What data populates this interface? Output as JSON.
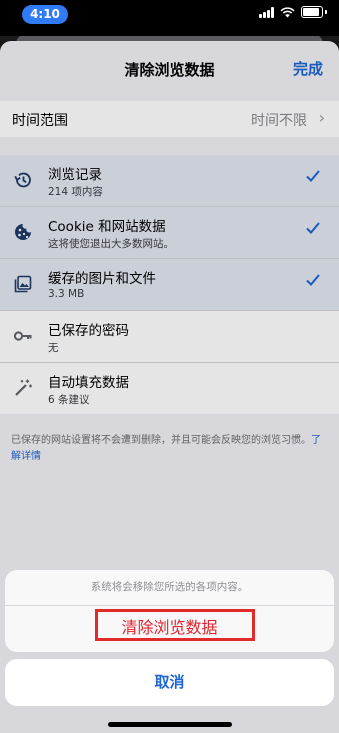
{
  "status_bar": {
    "time": "4:10"
  },
  "sheet": {
    "title": "清除浏览数据",
    "done_label": "完成",
    "time_range": {
      "label": "时间范围",
      "value": "时间不限"
    },
    "items": [
      {
        "title": "浏览记录",
        "subtitle": "214 项内容",
        "selected": true,
        "icon": "history-icon"
      },
      {
        "title": "Cookie 和网站数据",
        "subtitle": "这将使您退出大多数网站。",
        "selected": true,
        "icon": "cookie-icon"
      },
      {
        "title": "缓存的图片和文件",
        "subtitle": "3.3 MB",
        "selected": true,
        "icon": "image-icon"
      },
      {
        "title": "已保存的密码",
        "subtitle": "无",
        "selected": false,
        "icon": "key-icon"
      },
      {
        "title": "自动填充数据",
        "subtitle": "6 条建议",
        "selected": false,
        "icon": "magic-wand-icon"
      }
    ],
    "footnote": "已保存的网站设置将不会遭到删除，并且可能会反映您的浏览习惯。",
    "learn_more": "了解详情"
  },
  "action_sheet": {
    "message": "系统将会移除您所选的各项内容。",
    "confirm_label": "清除浏览数据",
    "cancel_label": "取消"
  },
  "colors": {
    "accent": "#1f66d1",
    "destructive": "#e0232f",
    "highlight": "#e12b2b"
  }
}
